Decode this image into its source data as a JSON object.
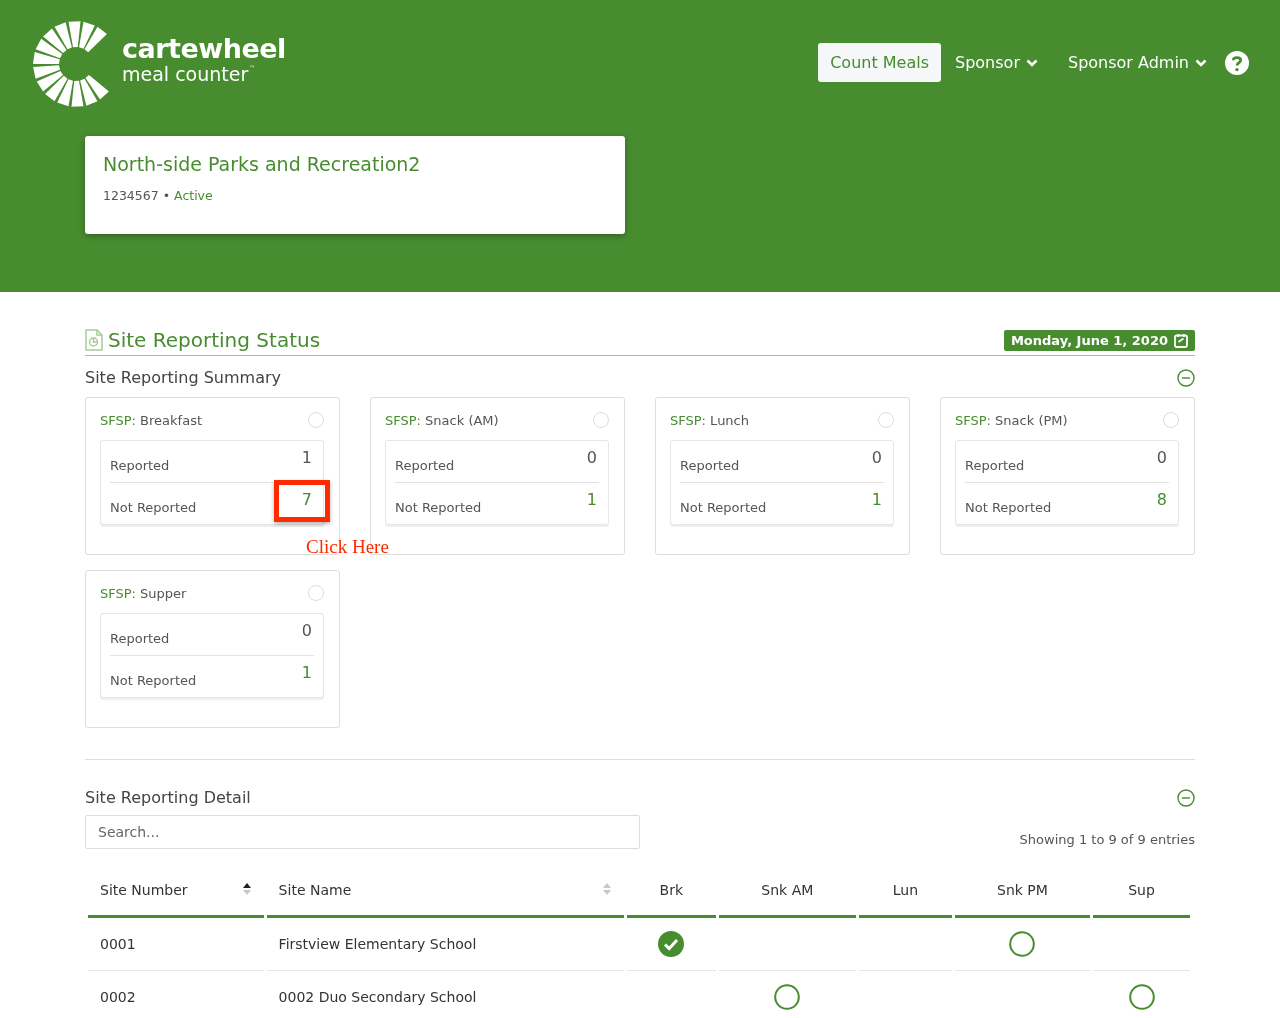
{
  "header": {
    "logo": {
      "name": "cartewheel",
      "tagline": "meal counter",
      "mark": "™"
    },
    "nav": [
      {
        "label": "Count Meals",
        "kind": "button"
      },
      {
        "label": "Sponsor",
        "kind": "dropdown"
      },
      {
        "label": "Sponsor Admin",
        "kind": "dropdown"
      }
    ],
    "sponsor_card": {
      "title": "North-side Parks and Recreation2",
      "number": "1234567",
      "separator": "•",
      "status": "Active"
    }
  },
  "section": {
    "title": "Site Reporting Status",
    "date": "Monday, June 1, 2020"
  },
  "summary": {
    "title": "Site Reporting Summary",
    "expanded": true,
    "cards": [
      {
        "program": "SFSP:",
        "meal": "Breakfast",
        "selected": false,
        "reported_label": "Reported",
        "reported": "1",
        "not_reported_label": "Not Reported",
        "not_reported": "7",
        "highlighted": true
      },
      {
        "program": "SFSP:",
        "meal": "Snack (AM)",
        "selected": false,
        "reported_label": "Reported",
        "reported": "0",
        "not_reported_label": "Not Reported",
        "not_reported": "1",
        "highlighted": false
      },
      {
        "program": "SFSP:",
        "meal": "Lunch",
        "selected": false,
        "reported_label": "Reported",
        "reported": "0",
        "not_reported_label": "Not Reported",
        "not_reported": "1",
        "highlighted": false
      },
      {
        "program": "SFSP:",
        "meal": "Snack (PM)",
        "selected": false,
        "reported_label": "Reported",
        "reported": "0",
        "not_reported_label": "Not Reported",
        "not_reported": "8",
        "highlighted": false
      },
      {
        "program": "SFSP:",
        "meal": "Supper",
        "selected": false,
        "reported_label": "Reported",
        "reported": "0",
        "not_reported_label": "Not Reported",
        "not_reported": "1",
        "highlighted": false
      }
    ],
    "annotation": "Click Here"
  },
  "detail": {
    "title": "Site Reporting Detail",
    "expanded": true,
    "search": {
      "placeholder": "Search..."
    },
    "info": "Showing 1 to 9 of 9 entries",
    "table": {
      "columns": [
        {
          "label": "Site Number",
          "sortable": true,
          "sorted_ascending": true
        },
        {
          "label": "Site Name",
          "sortable": true,
          "sorted_ascending": false
        },
        {
          "label": "Brk",
          "sortable": false
        },
        {
          "label": "Snk AM",
          "sortable": false
        },
        {
          "label": "Lun",
          "sortable": false
        },
        {
          "label": "Snk PM",
          "sortable": false
        },
        {
          "label": "Sup",
          "sortable": false
        }
      ],
      "rows": [
        {
          "site_number": "0001",
          "site_name": "Firstview Elementary School",
          "meals": [
            {
              "due": true,
              "reported": true
            },
            {
              "due": false
            },
            {
              "due": false
            },
            {
              "due": true,
              "reported": false
            },
            {
              "due": false
            }
          ]
        },
        {
          "site_number": "0002",
          "site_name": "0002 Duo Secondary School",
          "meals": [
            {
              "due": false
            },
            {
              "due": true,
              "reported": false
            },
            {
              "due": false
            },
            {
              "due": false
            },
            {
              "due": true,
              "reported": false
            }
          ]
        }
      ]
    }
  }
}
